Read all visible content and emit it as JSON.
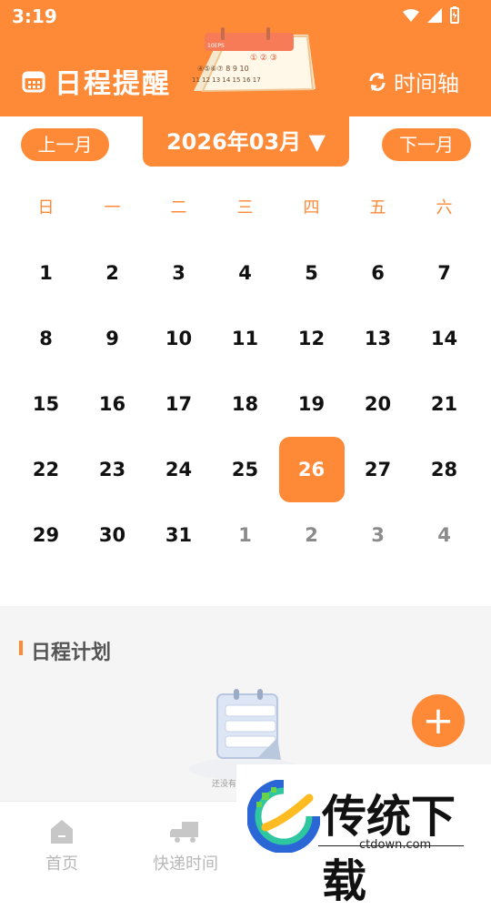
{
  "status": {
    "time": "3:19"
  },
  "header": {
    "title": "日程提醒",
    "timeline_label": "时间轴"
  },
  "month_nav": {
    "prev_label": "上一月",
    "current_month": "2026年03月",
    "next_label": "下一月"
  },
  "calendar": {
    "weekdays": [
      "日",
      "一",
      "二",
      "三",
      "四",
      "五",
      "六"
    ],
    "days": [
      {
        "label": "1"
      },
      {
        "label": "2"
      },
      {
        "label": "3"
      },
      {
        "label": "4"
      },
      {
        "label": "5"
      },
      {
        "label": "6"
      },
      {
        "label": "7"
      },
      {
        "label": "8"
      },
      {
        "label": "9"
      },
      {
        "label": "10"
      },
      {
        "label": "11"
      },
      {
        "label": "12"
      },
      {
        "label": "13"
      },
      {
        "label": "14"
      },
      {
        "label": "15"
      },
      {
        "label": "16"
      },
      {
        "label": "17"
      },
      {
        "label": "18"
      },
      {
        "label": "19"
      },
      {
        "label": "20"
      },
      {
        "label": "21"
      },
      {
        "label": "22"
      },
      {
        "label": "23"
      },
      {
        "label": "24"
      },
      {
        "label": "25"
      },
      {
        "label": "26",
        "selected": true
      },
      {
        "label": "27"
      },
      {
        "label": "28"
      },
      {
        "label": "29"
      },
      {
        "label": "30"
      },
      {
        "label": "31"
      },
      {
        "label": "1",
        "other_month": true
      },
      {
        "label": "2",
        "other_month": true
      },
      {
        "label": "3",
        "other_month": true
      },
      {
        "label": "4",
        "other_month": true
      }
    ],
    "mini_calendar": {
      "top_label": "10EPS",
      "row1": "① ② ③",
      "row2": "④⑤⑥⑦ 8 9 10",
      "row3": "11 12 13 14 15 16 17"
    }
  },
  "plan": {
    "title": "日程计划",
    "empty_caption": "还没有"
  },
  "bottom_nav": {
    "home_label": "首页",
    "express_label": "快递时间"
  },
  "watermark": {
    "brand": "传统下载",
    "url": "ctdown.com"
  },
  "colors": {
    "accent": "#fe8937",
    "header": "#fe8937",
    "muted": "#b8b8b8"
  }
}
